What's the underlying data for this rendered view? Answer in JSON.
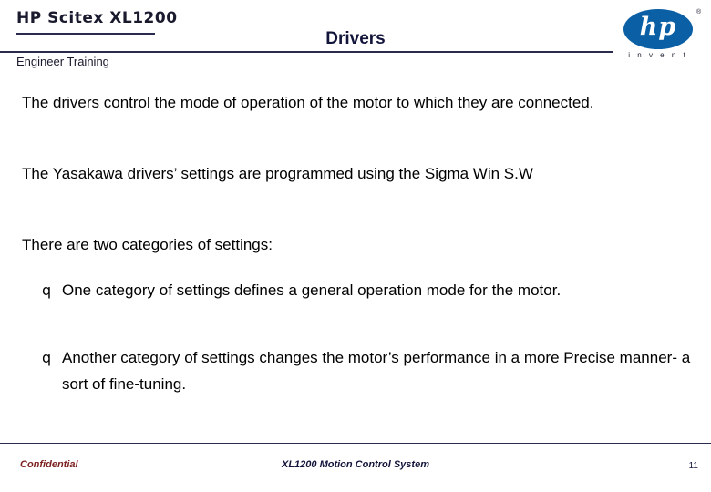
{
  "header": {
    "brand": "HP Scitex XL1200",
    "subtitle": "Engineer  Training",
    "slide_title": "Drivers",
    "logo": {
      "wordmark": "hp",
      "tagline": "i n v e n t",
      "trademark": "®"
    }
  },
  "body": {
    "paragraphs": [
      "The drivers control the mode of operation of the motor to which they are connected.",
      "The Yasakawa drivers’ settings are programmed using the Sigma Win S.W",
      "There are two categories of settings:"
    ],
    "bullets": [
      {
        "marker": "q",
        "text": "One category of settings defines a general operation mode for the motor."
      },
      {
        "marker": "q",
        "text": "Another category of settings changes the motor’s performance in a more Precise manner- a sort of fine-tuning."
      }
    ]
  },
  "footer": {
    "confidential": "Confidential",
    "center": "XL1200 Motion Control System",
    "page": "11"
  },
  "colors": {
    "rule": "#2b2b4d",
    "logo_blue": "#0b5fa5",
    "confidential_red": "#7b1f1f"
  }
}
